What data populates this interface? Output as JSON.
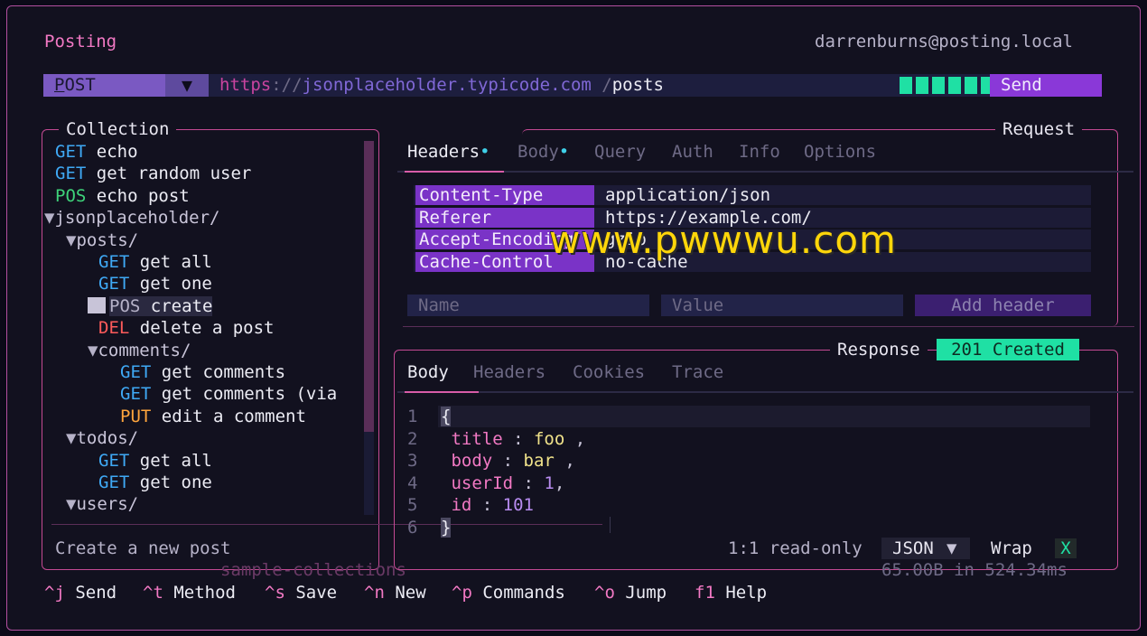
{
  "app": {
    "title": "Posting",
    "user": "darrenburns@posting.local"
  },
  "urlbar": {
    "method": "POST",
    "method_hotkey": "P",
    "url_proto": "https",
    "url_sep": "://",
    "url_host": "jsonplaceholder.typicode.com",
    "url_path_sep": "/",
    "url_path": "posts",
    "send_label": "Send",
    "progress_blocks": 7
  },
  "collection": {
    "title": "Collection",
    "footer_name": "sample-collections",
    "description": "Create a new post",
    "items": [
      {
        "indent": 0,
        "kind": "request",
        "method": "GET",
        "name": "echo"
      },
      {
        "indent": 0,
        "kind": "request",
        "method": "GET",
        "name": "get random user"
      },
      {
        "indent": 0,
        "kind": "request",
        "method": "POS",
        "name": "echo post"
      },
      {
        "indent": 0,
        "kind": "folder",
        "name": "jsonplaceholder/"
      },
      {
        "indent": 1,
        "kind": "folder",
        "name": "posts/"
      },
      {
        "indent": 2,
        "kind": "request",
        "method": "GET",
        "name": "get all"
      },
      {
        "indent": 2,
        "kind": "request",
        "method": "GET",
        "name": "get one"
      },
      {
        "indent": 2,
        "kind": "request",
        "method": "POS",
        "name": "create",
        "selected": true
      },
      {
        "indent": 2,
        "kind": "request",
        "method": "DEL",
        "name": "delete a post"
      },
      {
        "indent": 2,
        "kind": "folder",
        "name": "comments/"
      },
      {
        "indent": 3,
        "kind": "request",
        "method": "GET",
        "name": "get comments"
      },
      {
        "indent": 3,
        "kind": "request",
        "method": "GET",
        "name": "get comments (via"
      },
      {
        "indent": 3,
        "kind": "request",
        "method": "PUT",
        "name": "edit a comment"
      },
      {
        "indent": 1,
        "kind": "folder",
        "name": "todos/"
      },
      {
        "indent": 2,
        "kind": "request",
        "method": "GET",
        "name": "get all"
      },
      {
        "indent": 2,
        "kind": "request",
        "method": "GET",
        "name": "get one"
      },
      {
        "indent": 1,
        "kind": "folder",
        "name": "users/"
      }
    ]
  },
  "request": {
    "title": "Request",
    "tabs": [
      "Headers",
      "Body",
      "Query",
      "Auth",
      "Info",
      "Options"
    ],
    "tab_dots": [
      "•",
      "•"
    ],
    "headers": [
      {
        "key": "Content-Type",
        "value": "application/json"
      },
      {
        "key": "Referer",
        "value": "https://example.com/"
      },
      {
        "key": "Accept-Encoding",
        "value": "gzip"
      },
      {
        "key": "Cache-Control",
        "value": "no-cache"
      }
    ],
    "name_placeholder": "Name",
    "value_placeholder": "Value",
    "add_header_label": "Add header"
  },
  "response": {
    "title": "Response",
    "status": "201 Created",
    "tabs": [
      "Body",
      "Headers",
      "Cookies",
      "Trace"
    ],
    "body_lines": [
      {
        "n": "1",
        "text": "{"
      },
      {
        "n": "2",
        "key": "title",
        "val": "foo",
        "type": "str"
      },
      {
        "n": "3",
        "key": "body",
        "val": "bar",
        "type": "str"
      },
      {
        "n": "4",
        "key": "userId",
        "val": "1",
        "type": "num"
      },
      {
        "n": "5",
        "key": "id",
        "val": "101",
        "type": "num"
      },
      {
        "n": "6",
        "text": "}"
      }
    ],
    "cursor": "1:1",
    "mode": "read-only",
    "format": "JSON",
    "wrap_label": "Wrap",
    "wrap_value": "X",
    "size_label": "65.00B in 524.34ms"
  },
  "footer": [
    {
      "key": "^j",
      "label": "Send"
    },
    {
      "key": "^t",
      "label": "Method"
    },
    {
      "key": "^s",
      "label": "Save"
    },
    {
      "key": "^n",
      "label": "New"
    },
    {
      "key": "^p",
      "label": "Commands"
    },
    {
      "key": "^o",
      "label": "Jump"
    },
    {
      "key": "f1",
      "label": "Help"
    }
  ],
  "watermark": "www.pwwwu.com",
  "colors": {
    "accent": "#8a38d8",
    "status_ok": "#1fe0a4",
    "border": "#c44a93",
    "title": "#f279c4"
  }
}
